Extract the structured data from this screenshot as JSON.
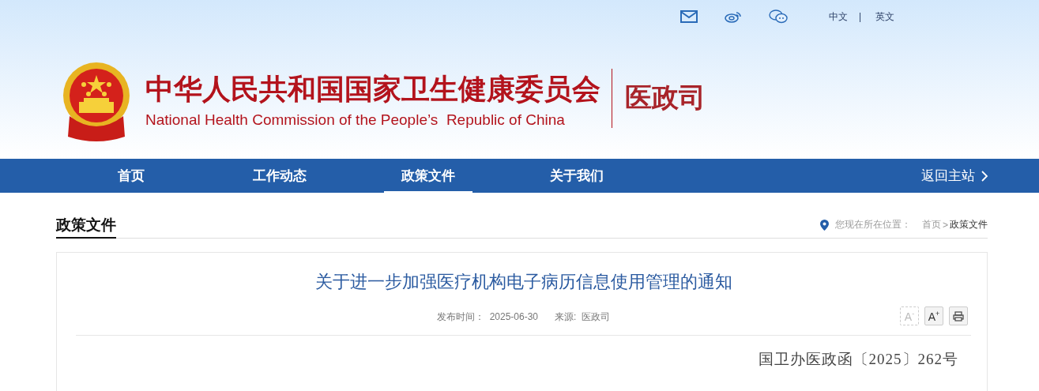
{
  "top_links": {
    "languages": [
      {
        "label": "中文",
        "selected": false
      },
      {
        "label": "英文",
        "selected": false
      }
    ],
    "separator": "|"
  },
  "header": {
    "title_cn": "中华人民共和国国家卫生健康委员会",
    "title_en": "National Health Commission of the People’s  Republic of China",
    "department": "医政司"
  },
  "nav": {
    "items": [
      {
        "label": "首页",
        "selected": false
      },
      {
        "label": "工作动态",
        "selected": false
      },
      {
        "label": "政策文件",
        "selected": true
      },
      {
        "label": "关于我们",
        "selected": false
      }
    ],
    "back_link": "返回主站"
  },
  "section": {
    "title": "政策文件",
    "breadcrumb": {
      "prefix": "您现在所在位置：",
      "home": "首页",
      "separator": ">",
      "current": "政策文件"
    }
  },
  "article": {
    "title": "关于进一步加强医疗机构电子病历信息使用管理的通知",
    "meta": [
      {
        "label": "发布时间：",
        "value": "2025-06-30"
      },
      {
        "label": "来源:",
        "value": "医政司"
      }
    ],
    "font_buttons": [
      {
        "label": "A",
        "sign": "-",
        "disabled": true
      },
      {
        "label": "A",
        "sign": "+",
        "disabled": false
      }
    ],
    "doc_number": "国卫办医政函〔2025〕262号"
  }
}
